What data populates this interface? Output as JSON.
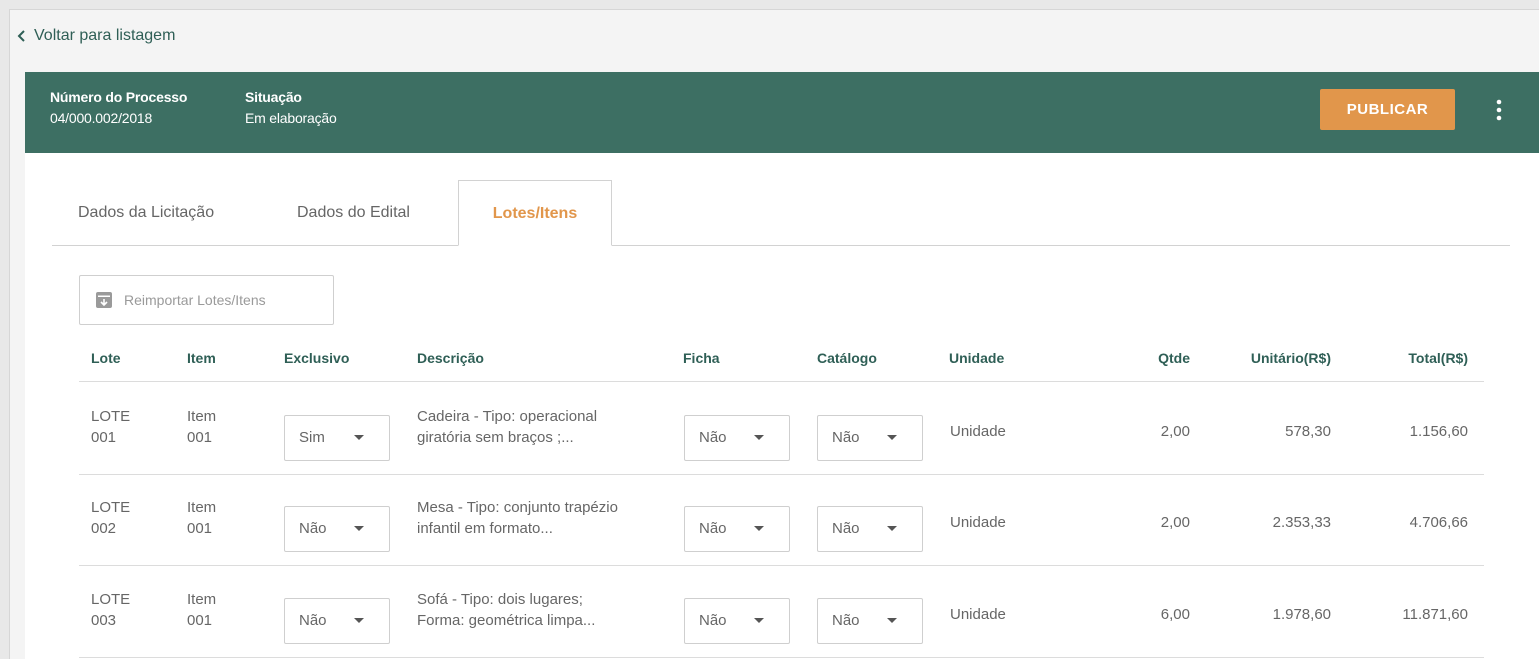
{
  "nav": {
    "back_label": "Voltar para listagem"
  },
  "header": {
    "process_label": "Número do Processo",
    "process_value": "04/000.002/2018",
    "status_label": "Situação",
    "status_value": "Em elaboração",
    "publish_label": "PUBLICAR",
    "more_icon": "more-vert-icon"
  },
  "tabs": [
    {
      "label": "Dados da Licitação",
      "active": false
    },
    {
      "label": "Dados do Edital",
      "active": false
    },
    {
      "label": "Lotes/Itens",
      "active": true
    }
  ],
  "toolbar": {
    "reimport_label": "Reimportar Lotes/Itens",
    "reimport_icon": "archive-icon"
  },
  "table": {
    "columns": [
      "Lote",
      "Item",
      "Exclusivo",
      "Descrição",
      "Ficha",
      "Catálogo",
      "Unidade",
      "Qtde",
      "Unitário(R$)",
      "Total(R$)"
    ],
    "rows": [
      {
        "lote": [
          "LOTE",
          "001"
        ],
        "item": [
          "Item",
          "001"
        ],
        "exclusivo": "Sim",
        "descricao": [
          "Cadeira - Tipo: operacional",
          "giratória sem braços ;..."
        ],
        "ficha": "Não",
        "catalogo": "Não",
        "unidade": "Unidade",
        "qtde": "2,00",
        "unitario": "578,30",
        "total": "1.156,60"
      },
      {
        "lote": [
          "LOTE",
          "002"
        ],
        "item": [
          "Item",
          "001"
        ],
        "exclusivo": "Não",
        "descricao": [
          "Mesa - Tipo: conjunto trapézio",
          "infantil em formato..."
        ],
        "ficha": "Não",
        "catalogo": "Não",
        "unidade": "Unidade",
        "qtde": "2,00",
        "unitario": "2.353,33",
        "total": "4.706,66"
      },
      {
        "lote": [
          "LOTE",
          "003"
        ],
        "item": [
          "Item",
          "001"
        ],
        "exclusivo": "Não",
        "descricao": [
          "Sofá - Tipo: dois lugares;",
          "Forma: geométrica limpa..."
        ],
        "ficha": "Não",
        "catalogo": "Não",
        "unidade": "Unidade",
        "qtde": "6,00",
        "unitario": "1.978,60",
        "total": "11.871,60"
      }
    ]
  },
  "colors": {
    "header_bg": "#3d6f63",
    "accent": "#e1964b",
    "heading_text": "#2f5f56"
  }
}
